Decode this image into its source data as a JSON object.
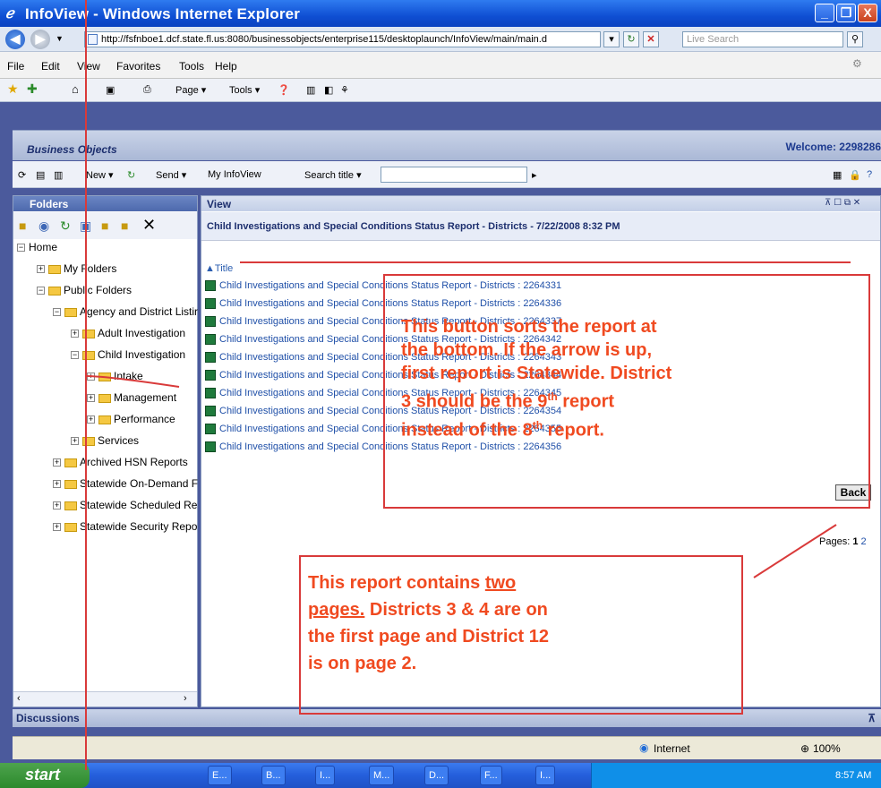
{
  "window": {
    "title": "InfoView - Windows Internet Explorer",
    "min_glyph": "_",
    "max_glyph": "❐",
    "close_glyph": "X"
  },
  "addressbar": {
    "url": "http://fsfnboe1.dcf.state.fl.us:8080/businessobjects/enterprise115/desktoplaunch/InfoView/main/main.d",
    "search_placeholder": "Live Search"
  },
  "menubar": {
    "items": [
      "File",
      "Edit",
      "View",
      "Favorites",
      "Tools",
      "Help"
    ]
  },
  "cmdbar": {
    "page_label": "Page ▾",
    "tools_label": "Tools ▾"
  },
  "bo": {
    "logo": "Business Objects",
    "welcome": "Welcome: 2298286",
    "toolbar": {
      "new_label": "New ▾",
      "send_label": "Send ▾",
      "myinfoview_label": "My InfoView",
      "searchtitle_label": "Search title ▾"
    }
  },
  "leftpane": {
    "header": "Folders",
    "tree": [
      {
        "label": "Home",
        "pm": "−"
      },
      {
        "label": "My Folders",
        "pm": "+"
      },
      {
        "label": "Public Folders",
        "pm": "−"
      },
      {
        "label": "Agency and District Listir",
        "pm": "−"
      },
      {
        "label": "Adult Investigation",
        "pm": "+"
      },
      {
        "label": "Child Investigation",
        "pm": "−"
      },
      {
        "label": "Intake",
        "pm": "+"
      },
      {
        "label": "Management",
        "pm": "+"
      },
      {
        "label": "Performance",
        "pm": "+"
      },
      {
        "label": "Services",
        "pm": "+"
      },
      {
        "label": "Archived HSN Reports",
        "pm": "+"
      },
      {
        "label": "Statewide On-Demand F",
        "pm": "+"
      },
      {
        "label": "Statewide Scheduled Re",
        "pm": "+"
      },
      {
        "label": "Statewide Security Repo",
        "pm": "+"
      }
    ]
  },
  "rightpane": {
    "header": "View",
    "subheader": "Child Investigations and Special Conditions Status Report - Districts - 7/22/2008 8:32 PM",
    "sort_label": "▲Title",
    "reports": [
      "Child Investigations and Special Conditions Status Report - Districts : 2264331",
      "Child Investigations and Special Conditions Status Report - Districts : 2264336",
      "Child Investigations and Special Conditions Status Report - Districts : 2264337",
      "Child Investigations and Special Conditions Status Report - Districts : 2264342",
      "Child Investigations and Special Conditions Status Report - Districts : 2264343",
      "Child Investigations and Special Conditions Status Report - Districts : 2264344",
      "Child Investigations and Special Conditions Status Report - Districts : 2264345",
      "Child Investigations and Special Conditions Status Report - Districts : 2264354",
      "Child Investigations and Special Conditions Status Report - Districts : 2264355",
      "Child Investigations and Special Conditions Status Report - Districts : 2264356"
    ],
    "back_label": "Back",
    "pages_label": "Pages:",
    "page_current": "1",
    "page_next": "2"
  },
  "discussions": "Discussions",
  "statusbar": {
    "zone": "Internet",
    "zoom": "100%"
  },
  "taskbar": {
    "start": "start",
    "tasks": [
      "E...",
      "B...",
      "I...",
      "M...",
      "D...",
      "F...",
      "I..."
    ],
    "clock": "8:57 AM"
  },
  "annotations": {
    "sort_note_lines": [
      "This button sorts the report at",
      "the bottom. If the arrow is up,",
      "first report is Statewide.  District"
    ],
    "sort_note_line4_pre": "3 should be the 9",
    "sort_note_line4_sup": "th",
    "sort_note_line4_post": " report",
    "sort_note_line5_pre": "instead of the 8",
    "sort_note_line5_sup": "th",
    "sort_note_line5_post": " report.",
    "pages_note_line1_pre": "This report contains ",
    "pages_note_line1_u": "two",
    "pages_note_line2_u": "pages.",
    "pages_note_line2_post": " Districts 3 & 4 are on",
    "pages_note_line3": "the first page and District 12",
    "pages_note_line4": "is on page 2."
  },
  "colors": {
    "annotation": "#f04a20",
    "annotation_border": "#d93a3a",
    "link": "#2050a8"
  }
}
